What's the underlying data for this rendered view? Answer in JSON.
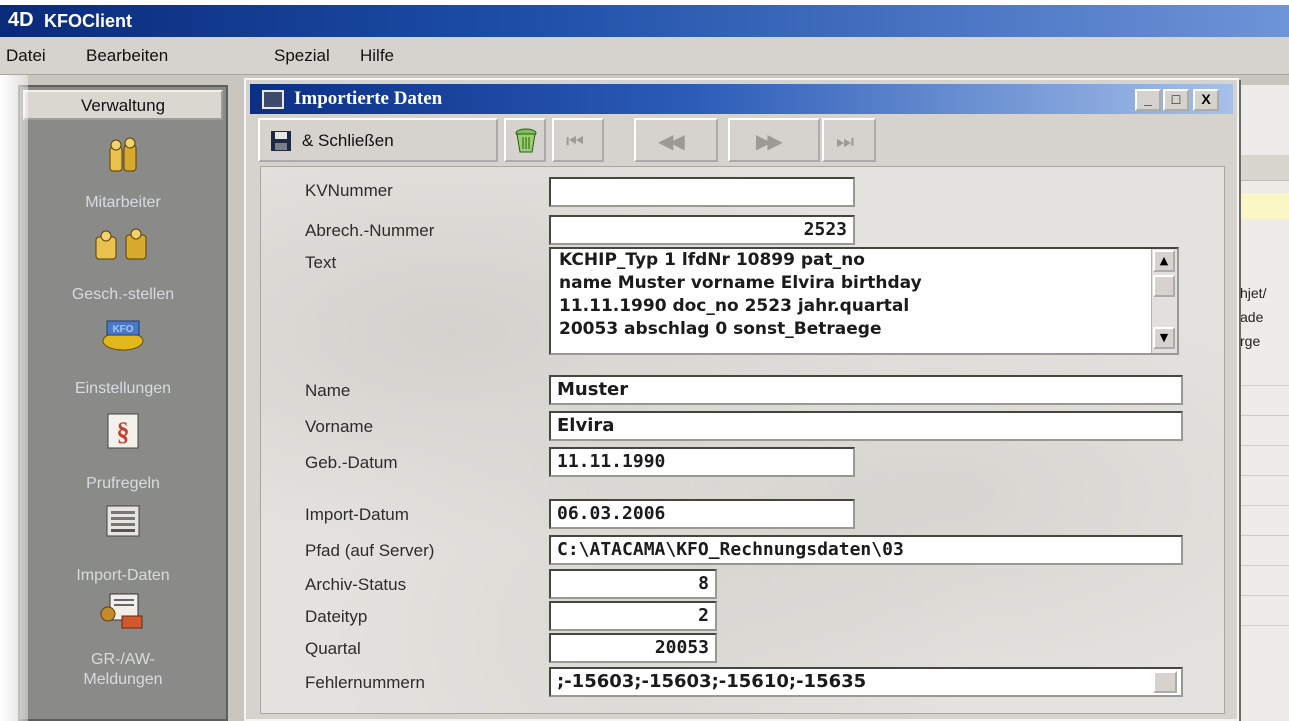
{
  "app": {
    "logo": "4D",
    "title": "KFOClient"
  },
  "menu": [
    "Datei",
    "Bearbeiten",
    "Spezial",
    "Hilfe"
  ],
  "nav": {
    "header": "Verwaltung",
    "items": [
      {
        "label": "Mitarbeiter",
        "icon": "employees-icon"
      },
      {
        "label": "Gesch.-stellen",
        "icon": "branches-icon"
      },
      {
        "label": "Einstellungen",
        "icon": "settings-icon"
      },
      {
        "label": "Prufregeln",
        "icon": "rules-icon"
      },
      {
        "label": "Import-Daten",
        "icon": "import-data-icon"
      },
      {
        "label": "GR-/AW-\nMeldungen",
        "icon": "messages-icon"
      }
    ]
  },
  "background_window": {
    "lines": [
      "hjet/",
      "ade",
      "rge"
    ]
  },
  "dialog": {
    "title": "Importierte Daten",
    "window_buttons": {
      "minimize": "_",
      "maximize": "□",
      "close": "X"
    },
    "toolbar": {
      "save_close_label": "& Schließen",
      "nav_first": "⏮",
      "nav_prev": "◀◀",
      "nav_next": "▶▶",
      "nav_last": "⏭"
    },
    "fields": {
      "kv_nummer": {
        "label": "KVNummer",
        "value": ""
      },
      "abrech_nummer": {
        "label": "Abrech.-Nummer",
        "value": "2523"
      },
      "text": {
        "label": "Text",
        "value": "KCHIP_Typ 1 lfdNr 10899 pat_no\nname Muster vorname Elvira birthday\n11.11.1990 doc_no 2523 jahr.quartal\n20053 abschlag 0 sonst_Betraege"
      },
      "name": {
        "label": "Name",
        "value": "Muster"
      },
      "vorname": {
        "label": "Vorname",
        "value": "Elvira"
      },
      "geb_datum": {
        "label": "Geb.-Datum",
        "value": "11.11.1990"
      },
      "import_datum": {
        "label": "Import-Datum",
        "value": "06.03.2006"
      },
      "pfad": {
        "label": "Pfad (auf Server)",
        "value": "C:\\ATACAMA\\KFO_Rechnungsdaten\\03"
      },
      "archiv_status": {
        "label": "Archiv-Status",
        "value": "8"
      },
      "dateityp": {
        "label": "Dateityp",
        "value": "2"
      },
      "quartal": {
        "label": "Quartal",
        "value": "20053"
      },
      "fehlernummern": {
        "label": "Fehlernummern",
        "value": ";-15603;-15603;-15610;-15635"
      }
    }
  },
  "colors": {
    "title_gradient_start": "#0b2f84",
    "title_gradient_end": "#a6c0ea",
    "nav_panel": "#8a8a88",
    "window_face": "#d6d3ce"
  }
}
